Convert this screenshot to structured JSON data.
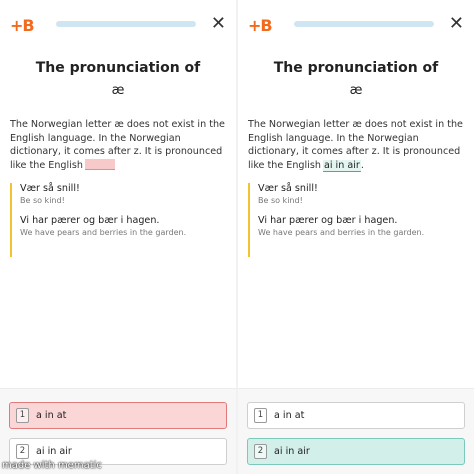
{
  "brand": {
    "logo_text": "+B",
    "accent": "#f26b1d"
  },
  "lesson": {
    "title": "The pronunciation of",
    "glyph": "æ",
    "body": "The Norwegian letter æ does not exist in the English language. In the Norwegian dictionary, it comes after z. It is pronounced like the English",
    "filled_answer": "ai in air",
    "examples": [
      {
        "sentence": "Vær så snill!",
        "translation": "Be so kind!"
      },
      {
        "sentence": "Vi har pærer og bær i hagen.",
        "translation": "We have pears and berries in the garden."
      }
    ]
  },
  "options": [
    {
      "key": "1",
      "label": "a in at"
    },
    {
      "key": "2",
      "label": "ai in air"
    }
  ],
  "states": {
    "left": {
      "selected_wrong": "1"
    },
    "right": {
      "selected_correct": "2"
    }
  },
  "icons": {
    "close": "close-icon",
    "logo": "brand-logo-icon"
  },
  "colors": {
    "wrong": "#fbd6d6",
    "correct": "#d3efe9",
    "quote_bar": "#f2c230",
    "progress": "#cfe6f2"
  },
  "watermark": "made with mematic",
  "close_glyph": "✕"
}
